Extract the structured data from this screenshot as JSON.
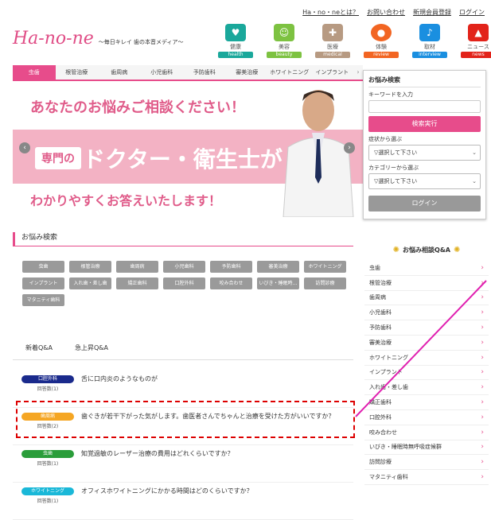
{
  "top_links": [
    "Ha・no・neとは？",
    "お問い合わせ",
    "新規会員登録",
    "ログイン"
  ],
  "logo": {
    "name": "Ha-no-ne",
    "tagline": "～毎日キレイ 歯の本音メディア～"
  },
  "categories": [
    {
      "jp": "健康",
      "en": "health",
      "color": "#1aa89b",
      "icon": "heart-pulse-icon"
    },
    {
      "jp": "美容",
      "en": "beauty",
      "color": "#7dc241",
      "icon": "face-icon"
    },
    {
      "jp": "医療",
      "en": "medical",
      "color": "#b79a82",
      "icon": "doctor-icon"
    },
    {
      "jp": "体験",
      "en": "review",
      "color": "#f26522",
      "icon": "chat-bubble-icon"
    },
    {
      "jp": "取材",
      "en": "interview",
      "color": "#1a8fe0",
      "icon": "microphone-icon"
    },
    {
      "jp": "ニュース",
      "en": "news",
      "color": "#e2231a",
      "icon": "siren-icon"
    }
  ],
  "nav": [
    "虫歯",
    "根管治療",
    "歯周病",
    "小児歯科",
    "予防歯科",
    "審美治療",
    "ホワイトニング",
    "インプラント"
  ],
  "banner": {
    "line1": "あなたのお悩みご相談ください！",
    "line2a": "専門の",
    "line2b": "ドクター・衛生士が",
    "line3": "わかりやすくお答えいたします！"
  },
  "search_box": {
    "title": "お悩み検索",
    "keyword_label": "キーワードを入力",
    "search_button": "検索実行",
    "symptom_label": "症状から選ぶ",
    "select_placeholder": "▽選択して下さい",
    "category_label": "カテゴリーから選ぶ",
    "login_button": "ログイン"
  },
  "section_title": "お悩み検索",
  "tags": [
    "虫歯",
    "根管治療",
    "歯周病",
    "小児歯科",
    "予防歯科",
    "審美治療",
    "ホワイトニング",
    "インプラント",
    "入れ歯・差し歯",
    "矯正歯科",
    "口腔外科",
    "咬み合わせ",
    "いびき・睡眠時…",
    "訪問診療",
    "マタニティ歯科"
  ],
  "tabs": [
    "新着Q&A",
    "急上昇Q&A"
  ],
  "questions": [
    {
      "cat": "口腔外科",
      "color": "#1a2a8c",
      "count": "回答数(1)",
      "title": "舌に口内炎のようなものが"
    },
    {
      "cat": "歯周病",
      "color": "#f5a623",
      "count": "回答数(2)",
      "title": "歯ぐきが若干下がった気がします。歯医者さんでちゃんと治療を受けた方がいいですか？"
    },
    {
      "cat": "虫歯",
      "color": "#2a9d3a",
      "count": "回答数(1)",
      "title": "知覚過敏のレーザー治療の費用はどれくらいですか？"
    },
    {
      "cat": "ホワイトニング",
      "color": "#1ab8d8",
      "count": "回答数(1)",
      "title": "オフィスホワイトニングにかかる時間はどのくらいですか？"
    }
  ],
  "qa_title": "お悩み相談Q&A",
  "qa_items": [
    "虫歯",
    "根管治療",
    "歯周病",
    "小児歯科",
    "予防歯科",
    "審美治療",
    "ホワイトニング",
    "インプラント",
    "入れ歯・差し歯",
    "矯正歯科",
    "口腔外科",
    "咬み合わせ",
    "いびき・睡眠時無呼吸症候群",
    "訪問診療",
    "マタニティ歯科"
  ]
}
